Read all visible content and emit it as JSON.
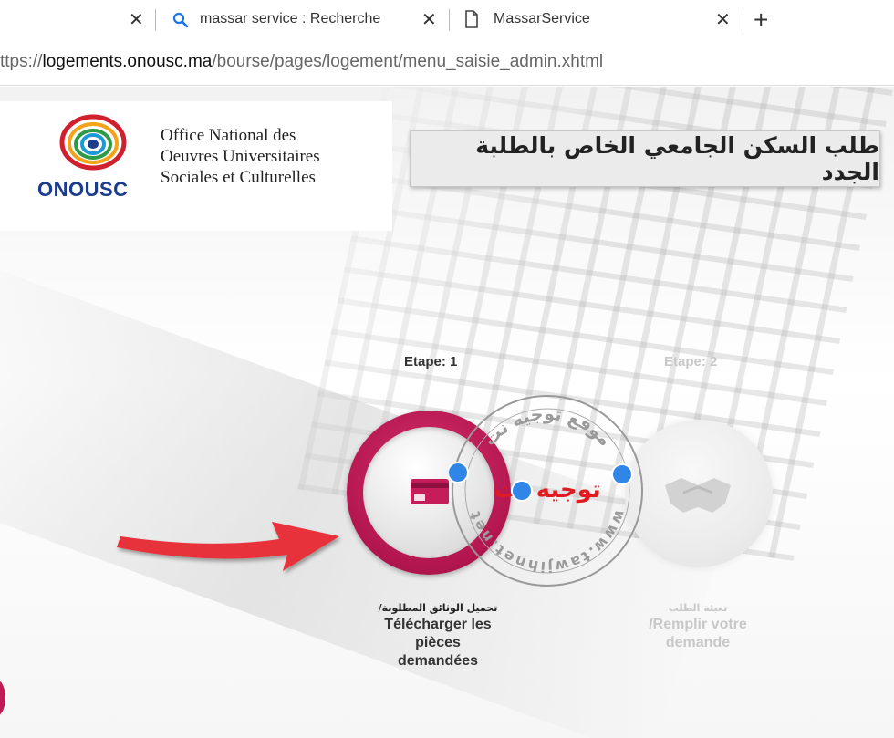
{
  "browser": {
    "tabs": [
      {
        "title": "",
        "close": "✕"
      },
      {
        "title": "massar service : Recherche",
        "close": "✕"
      },
      {
        "title": "MassarService",
        "close": "✕"
      }
    ],
    "new_tab": "+",
    "url_prefix": "ttps://",
    "url_host": "logements.onousc.ma",
    "url_path": "/bourse/pages/logement/menu_saisie_admin.xhtml"
  },
  "logo": {
    "acronym": "ONOUSC",
    "line1": "Office National des",
    "line2": "Oeuvres Universitaires",
    "line3": "Sociales et Culturelles"
  },
  "banner_title": "طلب السكن الجامعي الخاص بالطلبة الجدد",
  "steps": [
    {
      "label": "Etape: 1",
      "caption_ar": "/تحميل الوثائق المطلوبة",
      "caption_fr_1": "Télécharger les",
      "caption_fr_2": "pièces",
      "caption_fr_3": "demandées",
      "icon": "document-card-icon"
    },
    {
      "label": "Etape: 2",
      "caption_ar": "تعبئة الطلب",
      "caption_fr_1": "/Remplir votre",
      "caption_fr_2": "demande",
      "icon": "handshake-icon"
    }
  ],
  "watermark": {
    "top_text": "موقع توجيه نت",
    "center_text": "توجيه نت",
    "bottom_text": "www.tawjihnet.net"
  },
  "colors": {
    "accent": "#c01a55",
    "arrow": "#e8323a",
    "logo_blue": "#1d3c8c"
  }
}
